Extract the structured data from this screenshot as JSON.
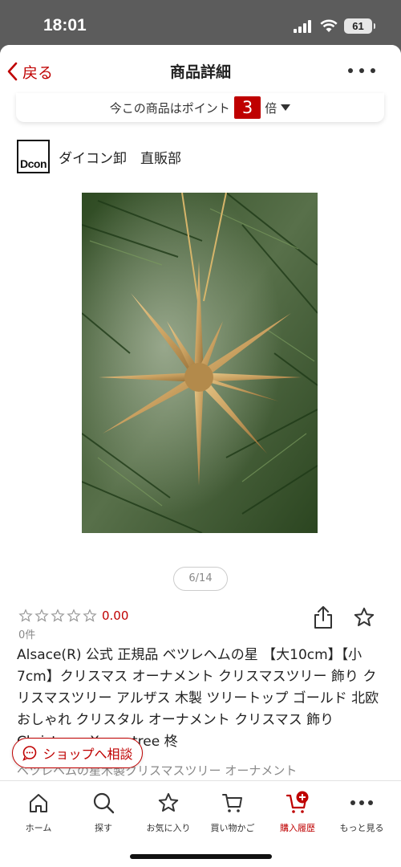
{
  "status_bar": {
    "time": "18:01",
    "battery": "61"
  },
  "nav": {
    "back_label": "戻る",
    "title": "商品詳細"
  },
  "points": {
    "prefix": "今この商品はポイント",
    "multiplier": "3",
    "suffix": "倍"
  },
  "shop": {
    "logo_text": "Dcon",
    "name": "ダイコン卸　直販部"
  },
  "gallery": {
    "pager": "6/14"
  },
  "product": {
    "rating": "0.00",
    "review_count": "0件",
    "title": "Alsace(R) 公式 正規品 ベツレヘムの星 【大10cm】【小7cm】クリスマス オーナメント クリスマスツリー 飾り クリスマスツリー アルザス 木製 ツリートップ ゴールド 北欧 おしゃれ クリスタル オーナメント クリスマス 飾り Christmas Xmas tree 柊",
    "subtitle": "ベツレヘムの星木製クリスマスツリー オーナメント"
  },
  "consult_button": {
    "label": "ショップへ相談"
  },
  "tabbar": {
    "items": [
      {
        "label": "ホーム",
        "icon": "home-icon"
      },
      {
        "label": "探す",
        "icon": "search-icon"
      },
      {
        "label": "お気に入り",
        "icon": "star-icon"
      },
      {
        "label": "買い物かご",
        "icon": "cart-icon"
      },
      {
        "label": "購入履歴",
        "icon": "purchase-history-icon"
      },
      {
        "label": "もっと見る",
        "icon": "more-dots-icon"
      }
    ],
    "active_index": 4
  },
  "colors": {
    "accent": "#bf0000",
    "text": "#222222",
    "muted": "#888888"
  }
}
